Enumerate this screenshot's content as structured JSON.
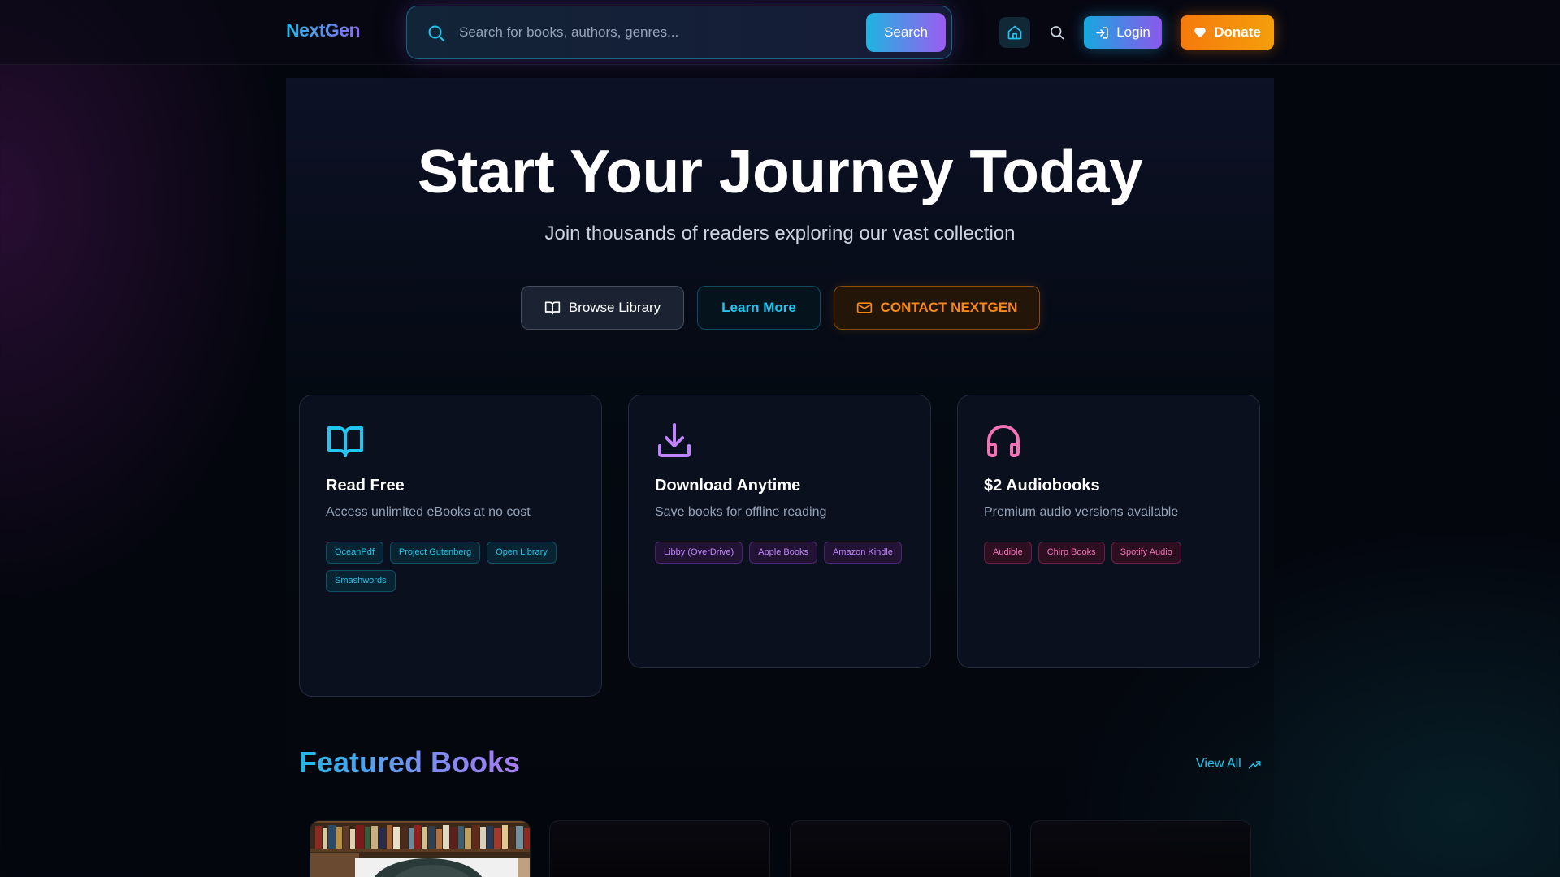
{
  "header": {
    "logo": "NextGen",
    "search": {
      "placeholder": "Search for books, authors, genres...",
      "button_label": "Search"
    },
    "login_label": "Login",
    "donate_label": "Donate"
  },
  "hero": {
    "title": "Start Your Journey Today",
    "subtitle": "Join thousands of readers exploring our vast collection",
    "buttons": {
      "browse": "Browse Library",
      "learn": "Learn More",
      "contact": "CONTACT NEXTGEN"
    }
  },
  "features": [
    {
      "icon": "book-open-icon",
      "title": "Read Free",
      "description": "Access unlimited eBooks at no cost",
      "tags": [
        "OceanPdf",
        "Project Gutenberg",
        "Open Library",
        "Smashwords"
      ],
      "accent": "#22c5ee"
    },
    {
      "icon": "download-icon",
      "title": "Download Anytime",
      "description": "Save books for offline reading",
      "tags": [
        "Libby (OverDrive)",
        "Apple Books",
        "Amazon Kindle"
      ],
      "accent": "#c084fc"
    },
    {
      "icon": "headphones-icon",
      "title": "$2 Audiobooks",
      "description": "Premium audio versions available",
      "tags": [
        "Audible",
        "Chirp Books",
        "Spotify Audio"
      ],
      "accent": "#f472b6"
    }
  ],
  "featured": {
    "title": "Featured Books",
    "view_all": "View All"
  },
  "colors": {
    "cyan": "#22c5ee",
    "purple": "#a855f7",
    "pink": "#ec4899",
    "orange": "#f5881a",
    "background": "#04060e"
  }
}
